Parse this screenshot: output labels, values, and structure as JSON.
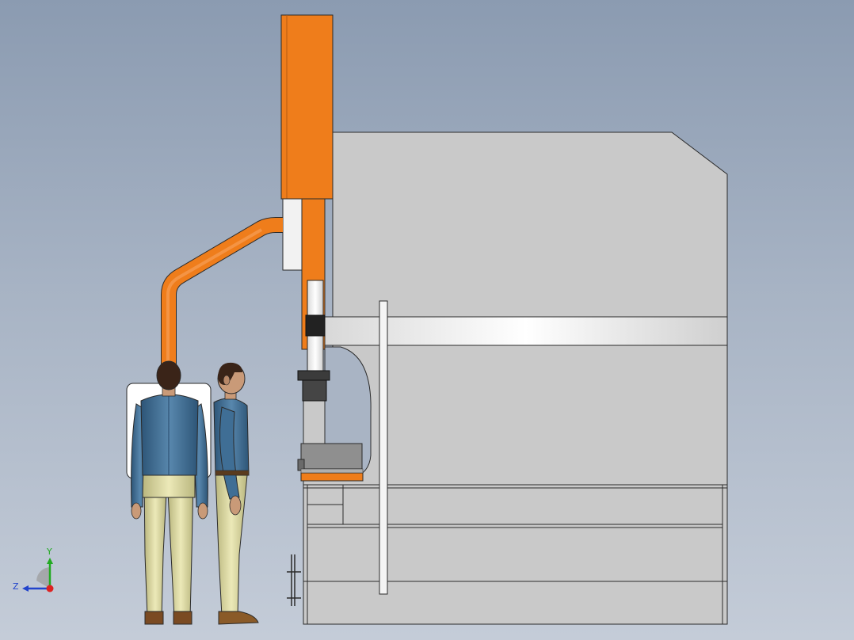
{
  "viewport": {
    "background_top": "#8b9bb1",
    "background_bottom": "#c4ccd8"
  },
  "colors": {
    "machine_frame": "#c8c8c8",
    "machine_edge": "#2a2a2a",
    "accent_orange": "#ef7d1b",
    "shirt_blue": "#3f6e95",
    "pants_khaki": "#d9d6a4",
    "skin": "#c99a78",
    "hair": "#3a2418"
  },
  "triad": {
    "y_label": "Y",
    "z_label": "Z",
    "y_color": "#22aa22",
    "z_color": "#2244cc",
    "x_color": "#dd2222"
  }
}
